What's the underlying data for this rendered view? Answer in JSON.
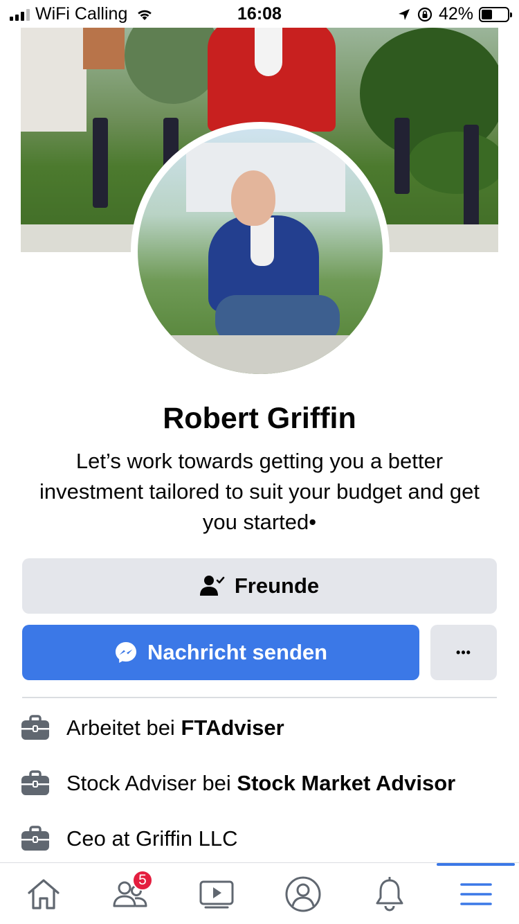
{
  "status_bar": {
    "carrier": "WiFi Calling",
    "time": "16:08",
    "battery_percent": "42%",
    "battery_level": 0.42
  },
  "profile": {
    "name": "Robert Griffin",
    "bio": "Let’s work towards getting you a better investment tailored to suit your budget and get you started•"
  },
  "actions": {
    "friends_label": "Freunde",
    "message_label": "Nachricht senden",
    "more_label": "•••"
  },
  "info": [
    {
      "prefix": "Arbeitet bei ",
      "strong": "FTAdviser",
      "icon": "briefcase-icon"
    },
    {
      "prefix": "Stock Adviser bei ",
      "strong": "Stock Market Advisor",
      "icon": "briefcase-icon"
    },
    {
      "prefix": "Ceo at Griffin LLC",
      "strong": "",
      "icon": "briefcase-icon"
    }
  ],
  "tabbar": {
    "tabs": [
      "home-icon",
      "friends-icon",
      "watch-icon",
      "profile-icon",
      "notifications-icon",
      "menu-icon"
    ],
    "friends_badge": "5",
    "active_tab": "menu-icon"
  },
  "colors": {
    "accent": "#3b78e7",
    "button_grey": "#e4e6eb",
    "badge": "#e41e3f",
    "icon_grey": "#606770"
  }
}
